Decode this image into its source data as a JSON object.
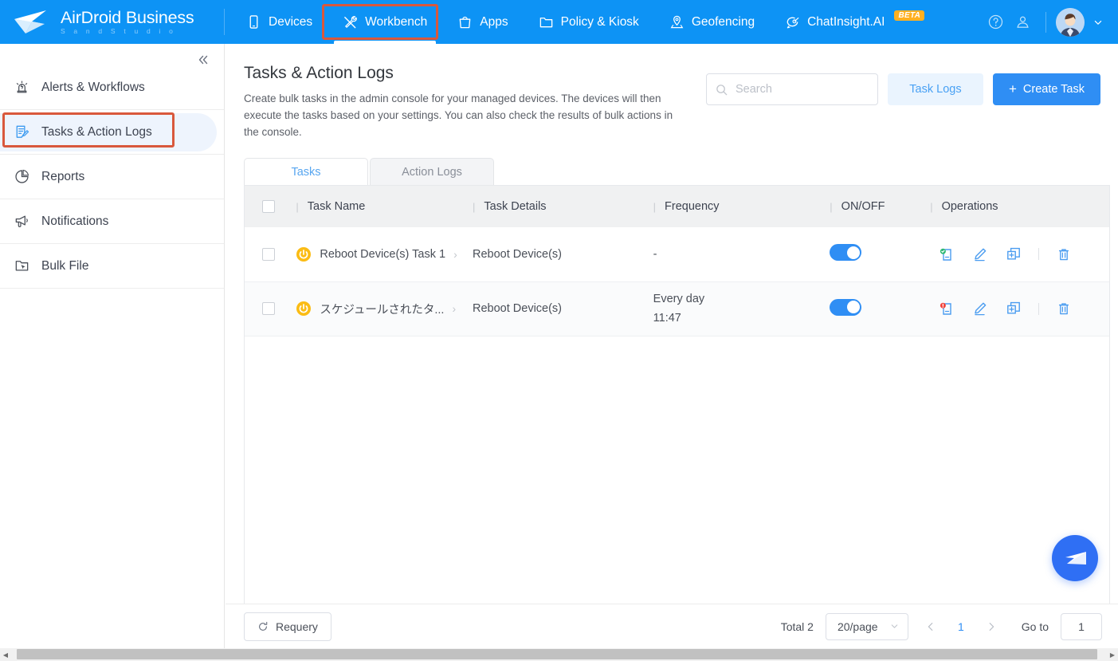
{
  "brand": {
    "title": "AirDroid Business",
    "subtitle": "S a n d   S t u d i o",
    "accent": "#0d93f5",
    "highlight": "#d9583c"
  },
  "topnav": {
    "items": [
      {
        "label": "Devices",
        "icon": "device-icon",
        "active": false
      },
      {
        "label": "Workbench",
        "icon": "tools-icon",
        "active": true
      },
      {
        "label": "Apps",
        "icon": "bag-icon",
        "active": false
      },
      {
        "label": "Policy & Kiosk",
        "icon": "folder-icon",
        "active": false
      },
      {
        "label": "Geofencing",
        "icon": "map-pin-icon",
        "active": false
      },
      {
        "label": "ChatInsight.AI",
        "icon": "chat-ai-icon",
        "active": false,
        "badge": "BETA"
      }
    ],
    "help_icon": "help-circle-icon",
    "account_icon": "user-circle-icon"
  },
  "sidebar": {
    "collapse_icon": "double-chevron-left-icon",
    "items": [
      {
        "label": "Alerts & Workflows",
        "icon": "alarm-icon",
        "active": false
      },
      {
        "label": "Tasks & Action Logs",
        "icon": "task-list-icon",
        "active": true
      },
      {
        "label": "Reports",
        "icon": "pie-chart-icon",
        "active": false
      },
      {
        "label": "Notifications",
        "icon": "megaphone-icon",
        "active": false
      },
      {
        "label": "Bulk File",
        "icon": "file-cursor-icon",
        "active": false
      }
    ]
  },
  "page": {
    "title": "Tasks & Action Logs",
    "description": "Create bulk tasks in the admin console for your managed devices. The devices will then execute the tasks based on your settings. You can also check the results of bulk actions in the console."
  },
  "search": {
    "placeholder": "Search",
    "value": "",
    "icon": "search-icon"
  },
  "actions": {
    "task_logs_label": "Task Logs",
    "create_task_label": "Create Task",
    "create_task_plus": "+"
  },
  "tabs": [
    {
      "label": "Tasks",
      "active": true
    },
    {
      "label": "Action Logs",
      "active": false
    }
  ],
  "table": {
    "columns": [
      "Task Name",
      "Task Details",
      "Frequency",
      "ON/OFF",
      "Operations"
    ],
    "separator": "|",
    "rows": [
      {
        "task_name": "Reboot Device(s) Task 1",
        "task_details": "Reboot Device(s)",
        "frequency_line1": "-",
        "frequency_line2": "",
        "toggle_on": true,
        "status_icon": "log-report-success-icon",
        "status_badge_color": "#2eb872",
        "icon": "power-icon"
      },
      {
        "task_name": "スケジュールされたタ...",
        "task_details": "Reboot Device(s)",
        "frequency_line1": "Every day",
        "frequency_line2": "11:47",
        "toggle_on": true,
        "status_icon": "log-report-alert-icon",
        "status_badge_color": "#f2453d",
        "icon": "power-icon"
      }
    ],
    "operation_icons": [
      "log-report-icon",
      "edit-pencil-icon",
      "duplicate-icon",
      "delete-trash-icon"
    ]
  },
  "footer": {
    "requery_label": "Requery",
    "requery_icon": "refresh-icon",
    "total_label": "Total 2",
    "page_size": "20/page",
    "prev_icon": "chevron-left-icon",
    "next_icon": "chevron-right-icon",
    "current_page": "1",
    "goto_label": "Go to",
    "goto_value": "1"
  },
  "fab": {
    "icon": "airdroid-plane-icon"
  }
}
